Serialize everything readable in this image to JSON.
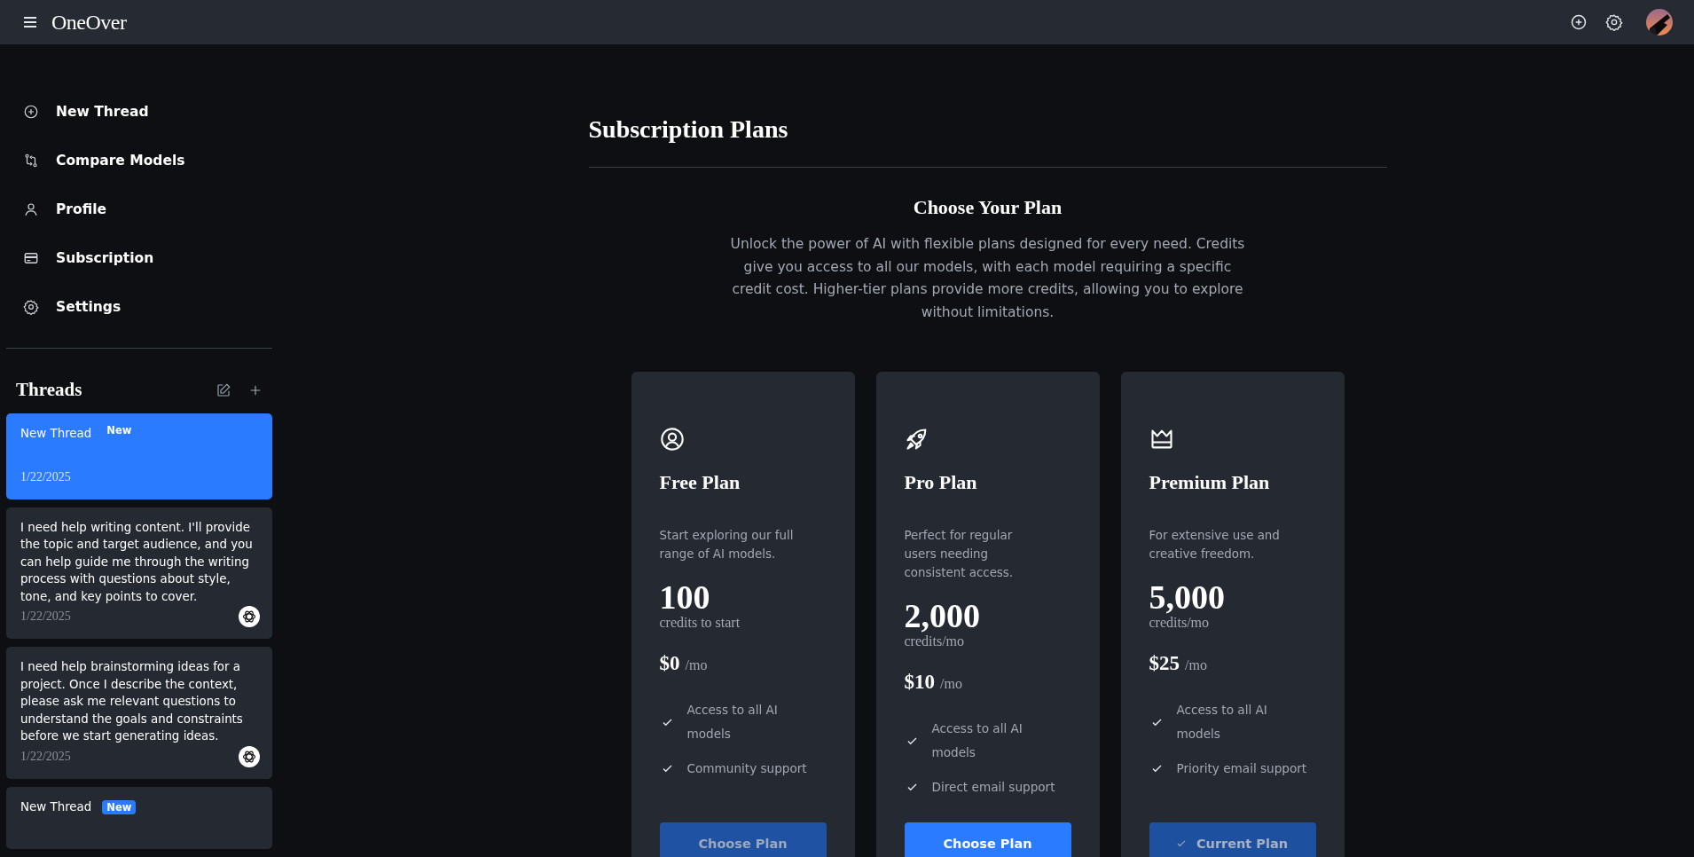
{
  "top_bar": {
    "brand": "OneOver"
  },
  "sidebar": {
    "nav": [
      {
        "label": "New Thread",
        "kind": "new"
      },
      {
        "label": "Compare Models",
        "kind": "compare"
      },
      {
        "label": "Profile",
        "kind": "profile"
      },
      {
        "label": "Subscription",
        "kind": "subscription"
      },
      {
        "label": "Settings",
        "kind": "settings"
      }
    ],
    "threads_title": "Threads",
    "threads": [
      {
        "kind": "new",
        "title": "New Thread",
        "badge": "New",
        "date": "1/22/2025",
        "selected": true
      },
      {
        "kind": "message",
        "title": "I need help writing content. I'll provide the topic and target audience, and you can help guide me through the writing process with questions about style, tone, and key points to cover.",
        "date": "1/22/2025",
        "selected": false
      },
      {
        "kind": "message",
        "title": "I need help brainstorming ideas for a project. Once I describe the context, please ask me relevant questions to understand the goals and constraints before we start generating ideas.",
        "date": "1/22/2025",
        "selected": false
      },
      {
        "kind": "new",
        "title": "New Thread",
        "badge": "New",
        "selected": false
      }
    ]
  },
  "page": {
    "title": "Subscription Plans",
    "heading": "Choose Your Plan",
    "intro": "Unlock the power of AI with flexible plans designed for every need. Credits give you access to all our models, with each model requiring a specific credit cost. Higher-tier plans provide more credits, allowing you to explore without limitations.",
    "plans": [
      {
        "kind": "free",
        "name": "Free Plan",
        "description": "Start exploring our full range of AI models.",
        "credits": "100",
        "credits_unit": "credits to start",
        "price": "$0",
        "period": "/mo",
        "features": [
          "Access to all AI models",
          "Community support"
        ],
        "button": {
          "label": "Choose Plan",
          "disabled": true,
          "current": false
        }
      },
      {
        "kind": "pro",
        "name": "Pro Plan",
        "description": "Perfect for regular users needing consistent access.",
        "credits": "2,000",
        "credits_unit": "credits/mo",
        "price": "$10",
        "period": "/mo",
        "features": [
          "Access to all AI models",
          "Direct email support"
        ],
        "button": {
          "label": "Choose Plan",
          "disabled": false,
          "current": false
        }
      },
      {
        "kind": "premium",
        "name": "Premium Plan",
        "description": "For extensive use and creative freedom.",
        "credits": "5,000",
        "credits_unit": "credits/mo",
        "price": "$25",
        "period": "/mo",
        "features": [
          "Access to all AI models",
          "Priority email support"
        ],
        "button": {
          "label": "Current Plan",
          "disabled": true,
          "current": true
        }
      }
    ]
  }
}
